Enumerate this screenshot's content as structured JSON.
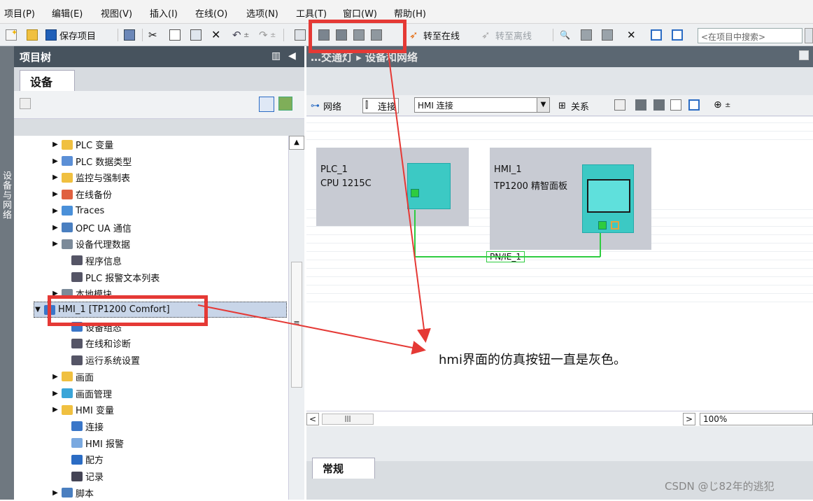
{
  "menu": {
    "items": [
      "项目(P)",
      "编辑(E)",
      "视图(V)",
      "插入(I)",
      "在线(O)",
      "选项(N)",
      "工具(T)",
      "窗口(W)",
      "帮助(H)"
    ]
  },
  "toolbar": {
    "save_label": "保存项目",
    "go_online_label": "转至在线",
    "go_offline_label": "转至离线",
    "search_placeholder": "<在项目中搜索>"
  },
  "sidebar_vertical": {
    "label": "设备与网络"
  },
  "project_tree": {
    "title": "项目树",
    "tab_label": "设备",
    "items": [
      {
        "label": "PLC 变量",
        "expand": "▶",
        "icon": "folder-icon"
      },
      {
        "label": "PLC 数据类型",
        "expand": "▶",
        "icon": "folder-icon"
      },
      {
        "label": "监控与强制表",
        "expand": "▶",
        "icon": "table-icon"
      },
      {
        "label": "在线备份",
        "expand": "▶",
        "icon": "backup-icon"
      },
      {
        "label": "Traces",
        "expand": "▶",
        "icon": "traces-icon"
      },
      {
        "label": "OPC UA 通信",
        "expand": "▶",
        "icon": "opcua-icon"
      },
      {
        "label": "设备代理数据",
        "expand": "▶",
        "icon": "proxy-icon"
      },
      {
        "label": "程序信息",
        "expand": "",
        "icon": "info-icon"
      },
      {
        "label": "PLC 报警文本列表",
        "expand": "",
        "icon": "list-icon"
      },
      {
        "label": "本地模块",
        "expand": "▶",
        "icon": "module-icon"
      },
      {
        "label": "HMI_1 [TP1200 Comfort]",
        "expand": "▼",
        "icon": "hmi-icon"
      },
      {
        "label": "设备组态",
        "expand": "",
        "icon": "config-icon"
      },
      {
        "label": "在线和诊断",
        "expand": "",
        "icon": "diag-icon"
      },
      {
        "label": "运行系统设置",
        "expand": "",
        "icon": "runtime-icon"
      },
      {
        "label": "画面",
        "expand": "▶",
        "icon": "folder-icon"
      },
      {
        "label": "画面管理",
        "expand": "▶",
        "icon": "folder-icon"
      },
      {
        "label": "HMI 变量",
        "expand": "▶",
        "icon": "folder-icon"
      },
      {
        "label": "连接",
        "expand": "",
        "icon": "connection-icon"
      },
      {
        "label": "HMI 报警",
        "expand": "",
        "icon": "alarm-icon"
      },
      {
        "label": "配方",
        "expand": "",
        "icon": "recipe-icon"
      },
      {
        "label": "记录",
        "expand": "",
        "icon": "log-icon"
      },
      {
        "label": "脚本",
        "expand": "▶",
        "icon": "script-icon"
      }
    ]
  },
  "breadcrumb": {
    "text": "…交通灯 ▸ 设备和网络"
  },
  "network_toolbar": {
    "network_label": "网络",
    "connections_label": "连接",
    "connection_type": "HMI 连接",
    "relations_label": "关系"
  },
  "devices": {
    "plc": {
      "name": "PLC_1",
      "model": "CPU 1215C"
    },
    "hmi": {
      "name": "HMI_1",
      "model": "TP1200 精智面板"
    },
    "network": {
      "label": "PN/IE_1"
    }
  },
  "zoom": {
    "value": "100%"
  },
  "properties": {
    "tab_label": "常规"
  },
  "annotation": {
    "text": "hmi界面的仿真按钮一直是灰色。"
  },
  "watermark": {
    "text": "CSDN @じ82年的逃犯"
  },
  "colors": {
    "highlight": "#e53935",
    "network_green": "#2ecc40",
    "device_teal": "#3cc9c4"
  }
}
